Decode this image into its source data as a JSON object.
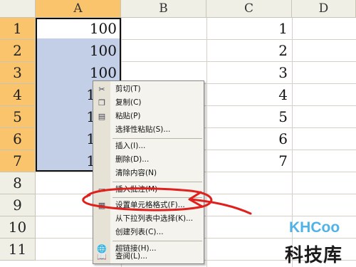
{
  "columns": [
    "A",
    "B",
    "C",
    "D"
  ],
  "rows": [
    "1",
    "2",
    "3",
    "4",
    "5",
    "6",
    "7",
    "8",
    "9",
    "10",
    "11"
  ],
  "column_a_values": [
    "100",
    "100",
    "100",
    "1",
    "1",
    "1",
    "1"
  ],
  "column_c_values": [
    "1",
    "2",
    "3",
    "4",
    "5",
    "6",
    "7"
  ],
  "context_menu": {
    "items": [
      {
        "label": "剪切(T)",
        "icon": "scissors-icon",
        "glyph": "✂"
      },
      {
        "label": "复制(C)",
        "icon": "copy-icon",
        "glyph": "❐"
      },
      {
        "label": "粘贴(P)",
        "icon": "paste-icon",
        "glyph": "▤"
      },
      {
        "label": "选择性粘贴(S)...",
        "icon": "",
        "glyph": ""
      },
      {
        "label": "插入(I)...",
        "icon": "",
        "glyph": ""
      },
      {
        "label": "删除(D)...",
        "icon": "",
        "glyph": ""
      },
      {
        "label": "清除内容(N)",
        "icon": "",
        "glyph": ""
      },
      {
        "label": "插入批注(M)",
        "icon": "comment-icon",
        "glyph": "▭"
      },
      {
        "label": "设置单元格格式(F)...",
        "icon": "format-cells-icon",
        "glyph": "▦"
      },
      {
        "label": "从下拉列表中选择(K)...",
        "icon": "",
        "glyph": ""
      },
      {
        "label": "创建列表(C)...",
        "icon": "",
        "glyph": ""
      },
      {
        "label": "超链接(H)...",
        "icon": "hyperlink-icon",
        "glyph": "🌐"
      },
      {
        "label": "查阅(L)...",
        "icon": "research-icon",
        "glyph": "📖"
      }
    ]
  },
  "annotation_color": "#e0201c",
  "selection_color": "#c2cfe6",
  "header_highlight_color": "#f9c46b",
  "watermark": {
    "logo": "KHCoo",
    "text": "科技库"
  }
}
